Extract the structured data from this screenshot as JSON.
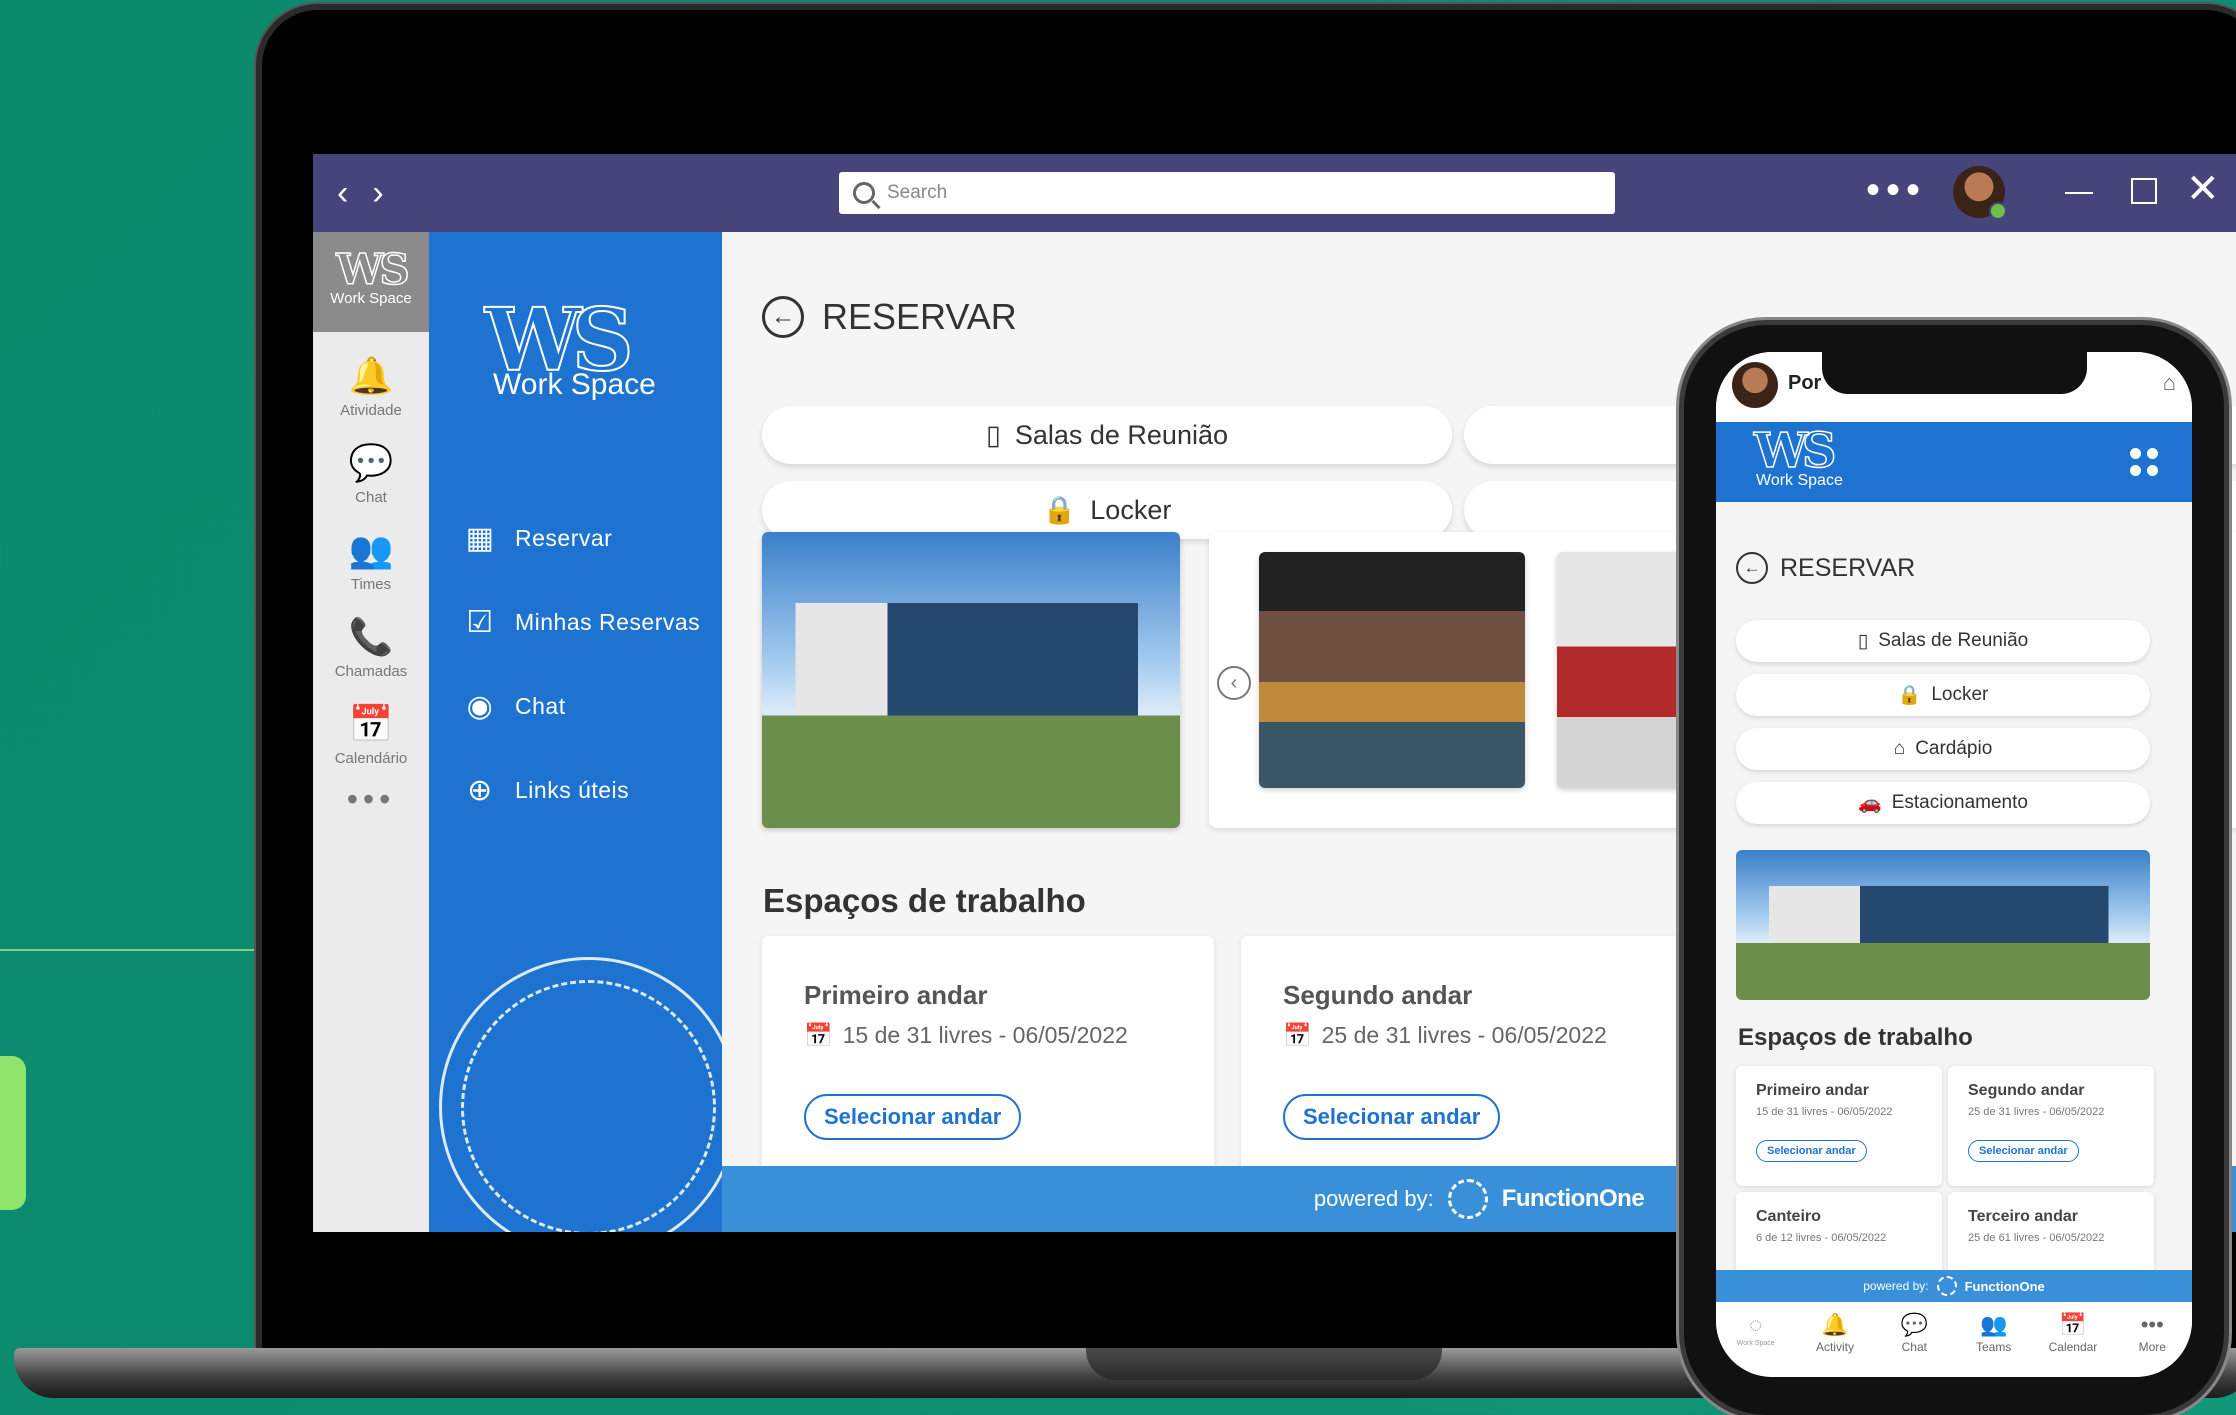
{
  "titlebar": {
    "back_arrow": "‹",
    "forward_arrow": "›",
    "search_placeholder": "Search",
    "more": "•••"
  },
  "rail": {
    "app": {
      "logo": "WS",
      "label": "Work Space"
    },
    "items": [
      {
        "icon": "bell-icon",
        "glyph": "🔔",
        "label": "Atividade"
      },
      {
        "icon": "chat-icon",
        "glyph": "💬",
        "label": "Chat"
      },
      {
        "icon": "teams-icon",
        "glyph": "👥",
        "label": "Times"
      },
      {
        "icon": "phone-icon",
        "glyph": "📞",
        "label": "Chamadas"
      },
      {
        "icon": "calendar-icon",
        "glyph": "📅",
        "label": "Calendário"
      }
    ],
    "more": "•••"
  },
  "sidebar": {
    "logo": "WS",
    "subtitle": "Work Space",
    "menu": [
      {
        "icon": "calendar-grid-icon",
        "glyph": "▦",
        "label": "Reservar"
      },
      {
        "icon": "calendar-check-icon",
        "glyph": "☑",
        "label": "Minhas Reservas"
      },
      {
        "icon": "bot-icon",
        "glyph": "◉",
        "label": "Chat"
      },
      {
        "icon": "globe-icon",
        "glyph": "⊕",
        "label": "Links úteis"
      }
    ]
  },
  "main": {
    "back_glyph": "←",
    "title": "RESERVAR",
    "options": [
      {
        "icon": "door-icon",
        "glyph": "▯",
        "label": "Salas de Reunião"
      },
      {
        "icon": "lock-icon",
        "glyph": "🔒",
        "label": "Locker"
      }
    ],
    "carousel_prev": "‹",
    "section_title": "Espaços de trabalho",
    "floors": [
      {
        "name": "Primeiro andar",
        "detail": "15 de 31 livres - 06/05/2022",
        "button": "Selecionar andar"
      },
      {
        "name": "Segundo andar",
        "detail": "25 de 31 livres - 06/05/2022",
        "button": "Selecionar andar"
      }
    ],
    "footer": {
      "powered": "powered by:",
      "brand": "FunctionOne"
    }
  },
  "phone": {
    "user_name": "Por",
    "logo": "WS",
    "subtitle": "Work Space",
    "title": "RESERVAR",
    "options": [
      {
        "icon": "door-icon",
        "glyph": "▯",
        "label": "Salas de Reunião"
      },
      {
        "icon": "lock-icon",
        "glyph": "🔒",
        "label": "Locker"
      },
      {
        "icon": "menu-icon",
        "glyph": "⌂",
        "label": "Cardápio"
      },
      {
        "icon": "car-icon",
        "glyph": "🚗",
        "label": "Estacionamento"
      }
    ],
    "section_title": "Espaços de trabalho",
    "floors": [
      {
        "name": "Primeiro andar",
        "detail": "15 de 31 livres - 06/05/2022",
        "button": "Selecionar andar"
      },
      {
        "name": "Segundo andar",
        "detail": "25 de 31 livres - 06/05/2022",
        "button": "Selecionar andar"
      },
      {
        "name": "Canteiro",
        "detail": "6 de 12 livres - 06/05/2022"
      },
      {
        "name": "Terceiro andar",
        "detail": "25 de 61 livres - 06/05/2022"
      }
    ],
    "footer": {
      "powered": "powered by:",
      "brand": "FunctionOne"
    },
    "tabs": [
      {
        "icon": "workspace-icon",
        "glyph": "◌",
        "label": "Work Space"
      },
      {
        "icon": "bell-icon",
        "glyph": "🔔",
        "label": "Activity"
      },
      {
        "icon": "chat-icon",
        "glyph": "💬",
        "label": "Chat"
      },
      {
        "icon": "teams-icon",
        "glyph": "👥",
        "label": "Teams"
      },
      {
        "icon": "calendar-icon",
        "glyph": "📅",
        "label": "Calendar"
      },
      {
        "icon": "more-icon",
        "glyph": "•••",
        "label": "More"
      }
    ]
  },
  "colors": {
    "background": "#0b8a6c",
    "titlebar": "#45457c",
    "brand_blue": "#1e73d0",
    "footer_blue": "#3a8fd9"
  }
}
